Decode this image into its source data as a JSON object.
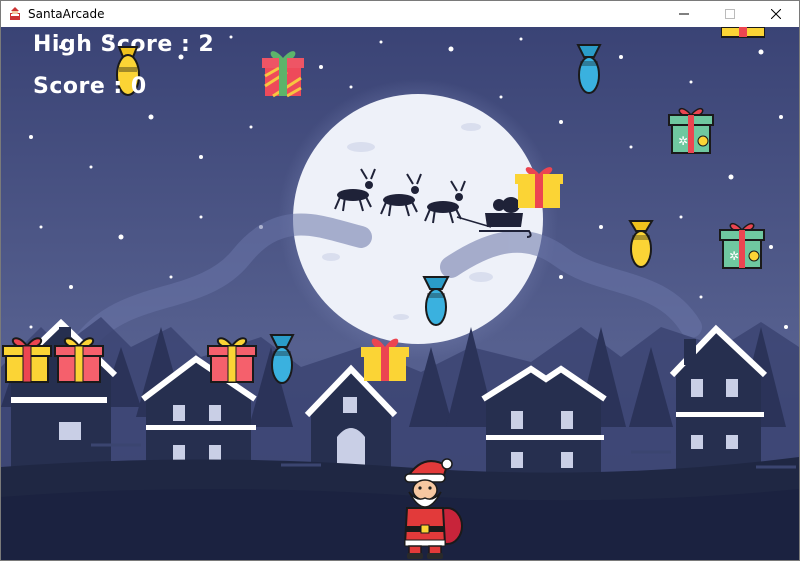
{
  "window": {
    "title": "SantaArcade",
    "controls": [
      "minimize",
      "maximize",
      "close"
    ]
  },
  "hud": {
    "high_score_label": "High Score : 2",
    "score_label": "Score : 0"
  },
  "colors": {
    "sky_top": "#3c4577",
    "sky_bottom": "#5a6596",
    "moon": "#f1f4fb",
    "town_dark": "#262f4f",
    "snow": "#ffffff",
    "gift_yellow": "#fbd435",
    "gift_red": "#ec4551",
    "gift_green": "#6fc8a0",
    "bomb_blue": "#3ab1df",
    "bomb_yellow": "#fbd435"
  },
  "sprites": {
    "gifts": [
      "gift-red-bow-yellow",
      "gift-green-ornament",
      "gift-yellow-ribbon",
      "gift-pink-ribbon",
      "gift-striped-green-bow"
    ],
    "bombs": [
      "bomb-blue",
      "bomb-yellow"
    ],
    "player": "santa-with-sack"
  }
}
